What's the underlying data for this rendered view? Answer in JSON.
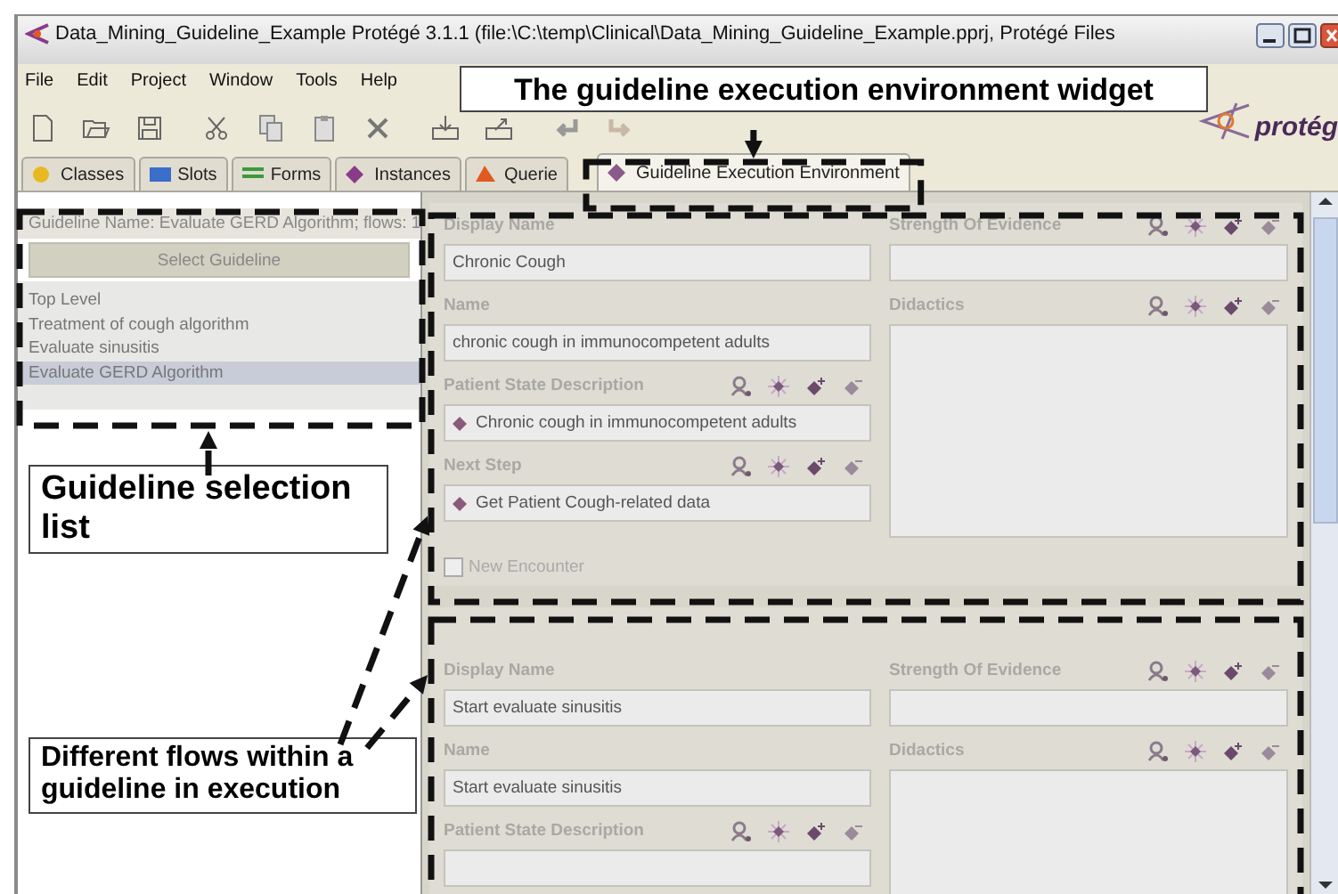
{
  "window": {
    "title": "Data_Mining_Guideline_Example  Protégé 3.1.1    (file:\\C:\\temp\\Clinical\\Data_Mining_Guideline_Example.pprj, Protégé Files"
  },
  "menu": [
    "File",
    "Edit",
    "Project",
    "Window",
    "Tools",
    "Help"
  ],
  "logo": "protég",
  "tabs": [
    {
      "label": "Classes",
      "color": "#e8b820",
      "selected": false
    },
    {
      "label": "Slots",
      "color": "#3a6ec8",
      "selected": false
    },
    {
      "label": "Forms",
      "color": "#3a9a3a",
      "selected": false
    },
    {
      "label": "Instances",
      "color": "#8a3a8a",
      "selected": false
    },
    {
      "label": "Querie",
      "color": "#e05a20",
      "selected": false
    },
    {
      "label": "Guideline Execution Environment",
      "color": "#8a5a8a",
      "selected": true
    }
  ],
  "guideline_panel": {
    "info": "Guideline Name: Evaluate GERD Algorithm; flows: 1",
    "button": "Select Guideline",
    "items": [
      {
        "label": "Top Level",
        "selected": false
      },
      {
        "label": "Treatment of cough algorithm",
        "selected": false
      },
      {
        "label": "Evaluate sinusitis",
        "selected": false
      },
      {
        "label": "Evaluate GERD Algorithm",
        "selected": true
      }
    ]
  },
  "flows": [
    {
      "left": [
        {
          "label": "Display Name",
          "kind": "text",
          "value": "Chronic Cough",
          "tools": false
        },
        {
          "label": "Name",
          "kind": "text",
          "value": "chronic cough in immunocompetent adults",
          "tools": false
        },
        {
          "label": "Patient State Description",
          "kind": "instance",
          "value": "Chronic cough in immunocompetent adults",
          "tools": true
        },
        {
          "label": "Next Step",
          "kind": "instance",
          "value": "Get Patient Cough-related data",
          "tools": true
        }
      ],
      "right": [
        {
          "label": "Strength Of Evidence",
          "kind": "text",
          "tools": true
        },
        {
          "label": "Didactics",
          "kind": "area",
          "tools": true
        }
      ],
      "new_encounter": {
        "label": "New Encounter",
        "checked": false
      }
    },
    {
      "left": [
        {
          "label": "Display Name",
          "kind": "text",
          "value": "Start evaluate sinusitis",
          "tools": false
        },
        {
          "label": "Name",
          "kind": "text",
          "value": "Start evaluate sinusitis",
          "tools": false
        },
        {
          "label": "Patient State Description",
          "kind": "instance",
          "tools": true
        }
      ],
      "right": [
        {
          "label": "Strength Of Evidence",
          "kind": "text",
          "tools": true
        },
        {
          "label": "Didactics",
          "kind": "area",
          "tools": true
        }
      ]
    }
  ],
  "annotations": [
    {
      "text": "The guideline execution environment widget"
    },
    {
      "text": "Guideline selection list"
    },
    {
      "text": "Different flows within a guideline in execution"
    }
  ]
}
